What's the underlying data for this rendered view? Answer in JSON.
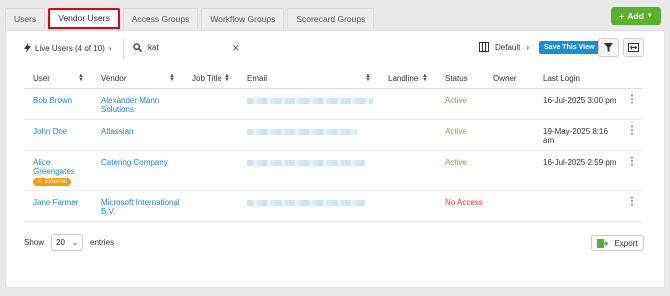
{
  "tabs": [
    "Users",
    "Vendor Users",
    "Access Groups",
    "Workflow Groups",
    "Scorecard Groups"
  ],
  "add_button": "Add",
  "toolbar": {
    "live_users": "Live Users (4 of 10)",
    "search_value": "kat",
    "view": "Default",
    "save_view": "Save This View"
  },
  "columns": [
    "User",
    "Vendor",
    "Job Title",
    "Email",
    "Landline",
    "Status",
    "Owner",
    "Last Login"
  ],
  "rows": [
    {
      "user": "Bob Brown",
      "vendor": "Alexander Mann Solutions",
      "job_title": "",
      "landline": "",
      "status": "Active",
      "owner": "",
      "last_login": "16-Jul-2025 3:00 pm"
    },
    {
      "user": "John Doe",
      "vendor": "Atlassian",
      "job_title": "",
      "landline": "",
      "status": "Active",
      "owner": "",
      "last_login": "19-May-2025 8:16 am"
    },
    {
      "user": "Alice Greengates",
      "badge": "External",
      "vendor": "Catering Company",
      "job_title": "",
      "landline": "",
      "status": "Active",
      "owner": "",
      "last_login": "16-Jul-2025 2:59 pm"
    },
    {
      "user": "Jane Farmer",
      "vendor": "Microsoft International B.V.",
      "job_title": "",
      "landline": "",
      "status": "No Access",
      "owner": "",
      "last_login": ""
    }
  ],
  "footer": {
    "show": "Show",
    "page_size": "20",
    "entries": "entries",
    "export": "Export"
  },
  "colors": {
    "accent": "#1e88c8",
    "add_green": "#5bb12c",
    "active": "#7cb342",
    "no_access": "#e53935",
    "highlight": "#e0001b"
  }
}
